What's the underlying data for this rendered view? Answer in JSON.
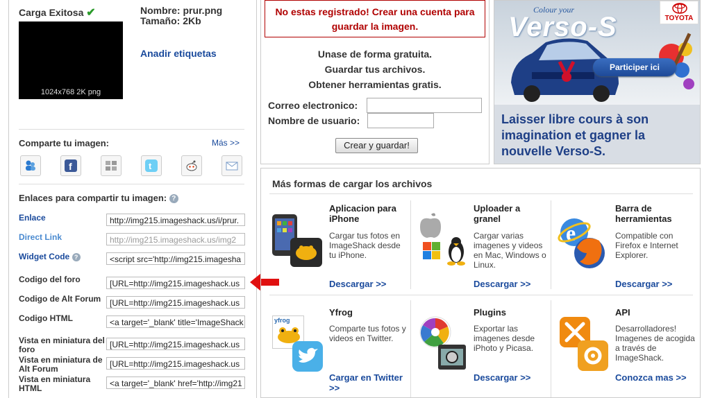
{
  "upload": {
    "status": "Carga Exitosa",
    "thumb_caption": "1024x768 2K png",
    "name_line": "Nombre: prur.png",
    "size_line": "Tamaño: 2Kb",
    "tags_link": "Anadir etiquetas"
  },
  "share": {
    "heading": "Comparte tu imagen:",
    "more_link": "Más >>"
  },
  "links": {
    "heading": "Enlaces para compartir tu imagen:",
    "rows": [
      {
        "label": "Enlace",
        "value": "http://img215.imageshack.us/i/prur."
      },
      {
        "label": "Direct Link",
        "value": "http://img215.imageshack.us/img2"
      },
      {
        "label": "Widget Code",
        "value": "<script src='http://img215.imagesha"
      },
      {
        "label": "Codigo del foro",
        "value": "[URL=http://img215.imageshack.us"
      },
      {
        "label": "Codigo de Alt Forum",
        "value": "[URL=http://img215.imageshack.us"
      },
      {
        "label": "Codigo HTML",
        "value": "<a target='_blank' title='ImageShack"
      },
      {
        "label": "Vista en miniatura del foro",
        "value": "[URL=http://img215.imageshack.us"
      },
      {
        "label": "Vista en miniatura de Alt Forum",
        "value": "[URL=http://img215.imageshack.us"
      },
      {
        "label": "Vista en miniatura HTML",
        "value": "<a target='_blank' href='http://img21"
      }
    ]
  },
  "register": {
    "warning": "No estas registrado! Crear una cuenta para guardar la imagen.",
    "benefits": [
      "Unase de forma gratuita.",
      "Guardar tus archivos.",
      "Obtener herramientas gratis."
    ],
    "email_label": "Correo electronico:",
    "username_label": "Nombre de usuario:",
    "submit_label": "Crear y guardar!"
  },
  "ad": {
    "brand": "TOYOTA",
    "tagline": "Colour your",
    "model": "Verso-S",
    "cta": "Participer ici",
    "text": "Laisser libre cours à son imagination et gagner la nouvelle Verso-S."
  },
  "more_ways": {
    "heading": "Más formas de cargar los archivos",
    "items": [
      {
        "title": "Aplicacion para iPhone",
        "desc": "Cargar tus fotos en ImageShack desde tu iPhone.",
        "link": "Descargar >>"
      },
      {
        "title": "Uploader a granel",
        "desc": "Cargar varias imagenes y videos en Mac, Windows o Linux.",
        "link": "Descargar >>"
      },
      {
        "title": "Barra de herramientas",
        "desc": "Compatible con Firefox e Internet Explorer.",
        "link": "Descargar >>"
      },
      {
        "title": "Yfrog",
        "desc": "Comparte tus fotos y videos en Twitter.",
        "link": "Cargar en Twitter >>"
      },
      {
        "title": "Plugins",
        "desc": "Exportar las imagenes desde iPhoto y Picasa.",
        "link": "Descargar >>"
      },
      {
        "title": "API",
        "desc": "Desarrolladores! Imagenes de acogida a través de ImageShack.",
        "link": "Conozca mas >>"
      }
    ],
    "yfrog_logo": "yfrog"
  },
  "colors": {
    "link": "#1a4a9c",
    "warning": "#b00000",
    "check": "#2a9a2a",
    "arrow": "#e01010"
  }
}
